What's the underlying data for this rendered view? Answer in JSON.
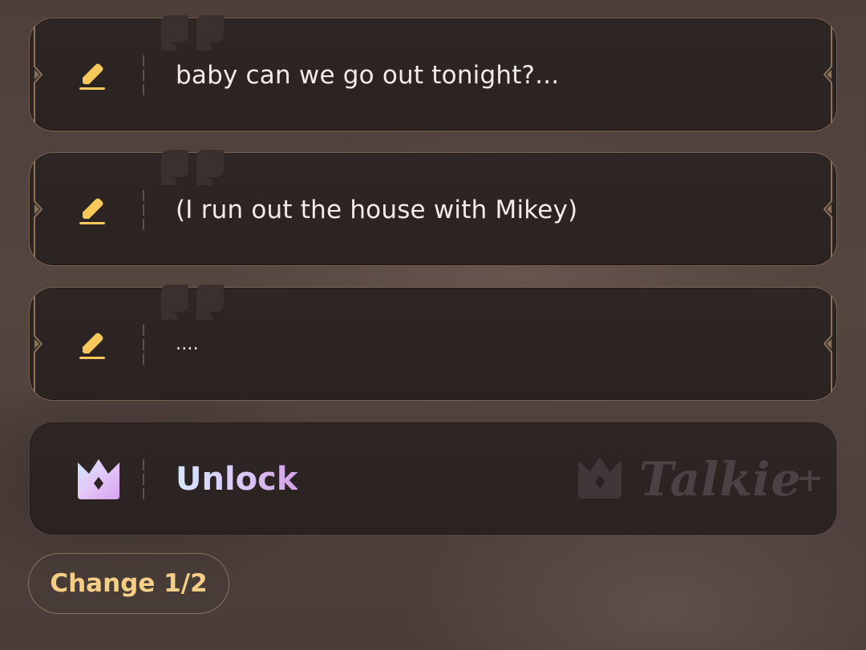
{
  "replies": [
    {
      "text": "baby can we go out tonight?...",
      "edit_icon": "pencil-icon"
    },
    {
      "text": "(I run out the house with Mikey)",
      "edit_icon": "pencil-icon"
    },
    {
      "text": "....",
      "edit_icon": "pencil-icon"
    }
  ],
  "unlock": {
    "label": "Unlock",
    "icon": "crown-icon",
    "watermark_text": "Talkie",
    "watermark_icon": "crown-icon"
  },
  "change_button": {
    "label": "Change 1/2"
  },
  "colors": {
    "card_bg": "#2a2322",
    "gold_accent": "#f6cf86",
    "pencil_yellow": "#f7c95a",
    "reply_text": "#f2ece8",
    "unlock_gradient_start": "#d6e6ff",
    "unlock_gradient_end": "#d6a0e6"
  }
}
